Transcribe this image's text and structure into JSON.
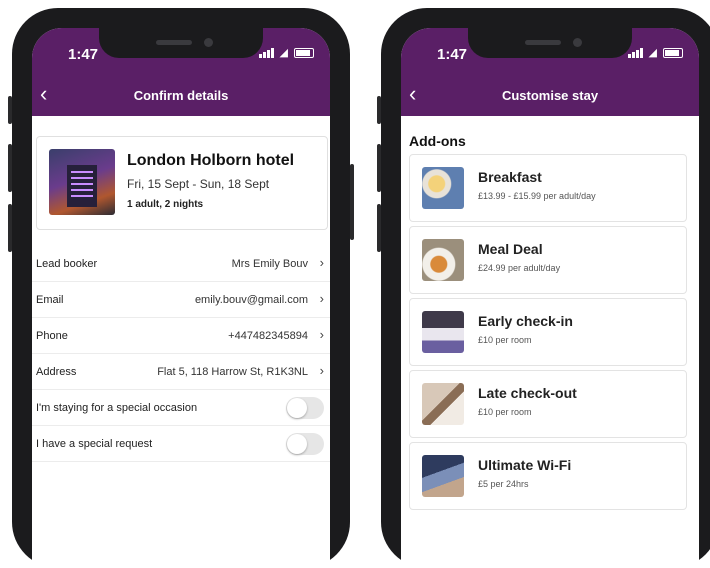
{
  "status": {
    "time": "1:47"
  },
  "left": {
    "nav_title": "Confirm details",
    "hotel": {
      "name": "London Holborn hotel",
      "dates": "Fri, 15 Sept - Sun, 18 Sept",
      "guests": "1 adult, 2 nights"
    },
    "rows": [
      {
        "label": "Lead booker",
        "value": "Mrs Emily Bouv"
      },
      {
        "label": "Email",
        "value": "emily.bouv@gmail.com"
      },
      {
        "label": "Phone",
        "value": "+447482345894"
      },
      {
        "label": "Address",
        "value": "Flat 5, 118 Harrow St, R1K3NL"
      }
    ],
    "toggles": [
      {
        "label": "I'm staying for a special occasion",
        "on": false
      },
      {
        "label": "I have a special request",
        "on": false
      }
    ]
  },
  "right": {
    "nav_title": "Customise stay",
    "section_title": "Add-ons",
    "addons": [
      {
        "name": "Breakfast",
        "price": "£13.99 - £15.99 per adult/day",
        "icon": "breakfast-photo"
      },
      {
        "name": "Meal Deal",
        "price": "£24.99 per adult/day",
        "icon": "meal-photo"
      },
      {
        "name": "Early check-in",
        "price": "£10 per room",
        "icon": "room-photo"
      },
      {
        "name": "Late check-out",
        "price": "£10 per room",
        "icon": "guest-photo"
      },
      {
        "name": "Ultimate Wi-Fi",
        "price": "£5 per 24hrs",
        "icon": "wifi-photo"
      }
    ]
  },
  "colors": {
    "brand": "#5a1f66"
  }
}
